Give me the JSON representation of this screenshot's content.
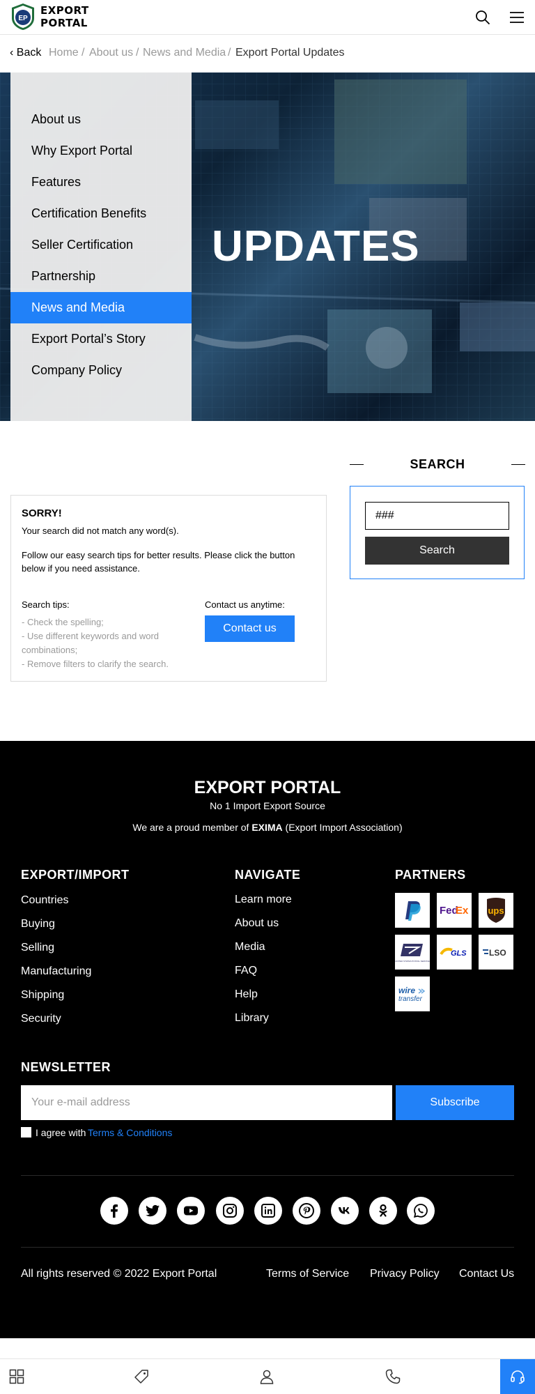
{
  "header": {
    "logo_line1": "EXPORT",
    "logo_line2": "PORTAL",
    "logo_monogram": "EP",
    "icons": [
      "search-icon",
      "menu-icon"
    ]
  },
  "breadcrumb": {
    "back": "Back",
    "items": [
      "Home",
      "About us",
      "News and Media",
      "Export Portal Updates"
    ],
    "separator": "/"
  },
  "hero": {
    "title": "UPDATES",
    "menu": [
      "About us",
      "Why Export Portal",
      "Features",
      "Certification Benefits",
      "Seller Certification",
      "Partnership",
      "News and Media",
      "Export Portal’s Story",
      "Company Policy"
    ],
    "active_index": 6
  },
  "search": {
    "title": "SEARCH",
    "input_value": "###",
    "button": "Search"
  },
  "no_results": {
    "title": "SORRY!",
    "message": "Your search did not match any word(s).",
    "follow": "Follow our easy search tips for better results. Please click the button below if you need assistance.",
    "tips_title": "Search tips:",
    "tips": [
      "- Check the spelling;",
      "- Use different keywords and word combinations;",
      "- Remove filters to clarify the search."
    ],
    "contact_label": "Contact us anytime:",
    "contact_button": "Contact us"
  },
  "footer": {
    "brand": "EXPORT PORTAL",
    "tagline": "No 1 Import Export Source",
    "member_prefix": "We are a proud member of ",
    "member_org": "EXIMA",
    "member_suffix": " (Export Import Association)",
    "col1_title": "EXPORT/IMPORT",
    "col1_links": [
      "Countries",
      "Buying",
      "Selling",
      "Manufacturing",
      "Shipping",
      "Security"
    ],
    "col2_title": "NAVIGATE",
    "col2_links": [
      "Learn more",
      "About us",
      "Media",
      "FAQ",
      "Help",
      "Library"
    ],
    "col3_title": "PARTNERS",
    "partners": [
      "PayPal",
      "FedEx",
      "ups",
      "USPS",
      "GLS",
      "LSO",
      "wire transfer"
    ],
    "partner_text": {
      "fedex_fed": "Fed",
      "fedex_ex": "Ex",
      "ups": "ups",
      "usps": "UNITED STATES POSTAL SERVICE",
      "gls": "GLS",
      "lso": "LSO",
      "wire1": "wire",
      "wire2": "transfer"
    },
    "newsletter_title": "NEWSLETTER",
    "email_placeholder": "Your e-mail address",
    "subscribe": "Subscribe",
    "agree_text": "I agree with",
    "agree_link": "Terms & Conditions",
    "social": [
      "facebook-icon",
      "twitter-icon",
      "youtube-icon",
      "instagram-icon",
      "linkedin-icon",
      "pinterest-icon",
      "vk-icon",
      "odnoklassniki-icon",
      "whatsapp-icon"
    ],
    "copyright": "All rights reserved © 2022 Export Portal",
    "bottom_links": [
      "Terms of Service",
      "Privacy Policy",
      "Contact Us"
    ]
  },
  "bottom_bar": {
    "icons": [
      "categories-icon",
      "tag-icon",
      "user-icon",
      "phone-icon",
      "support-headset-icon"
    ]
  },
  "colors": {
    "accent": "#2181f8",
    "dark_button": "#333333",
    "footer_bg": "#000000",
    "side_menu_bg": "#ececec"
  }
}
